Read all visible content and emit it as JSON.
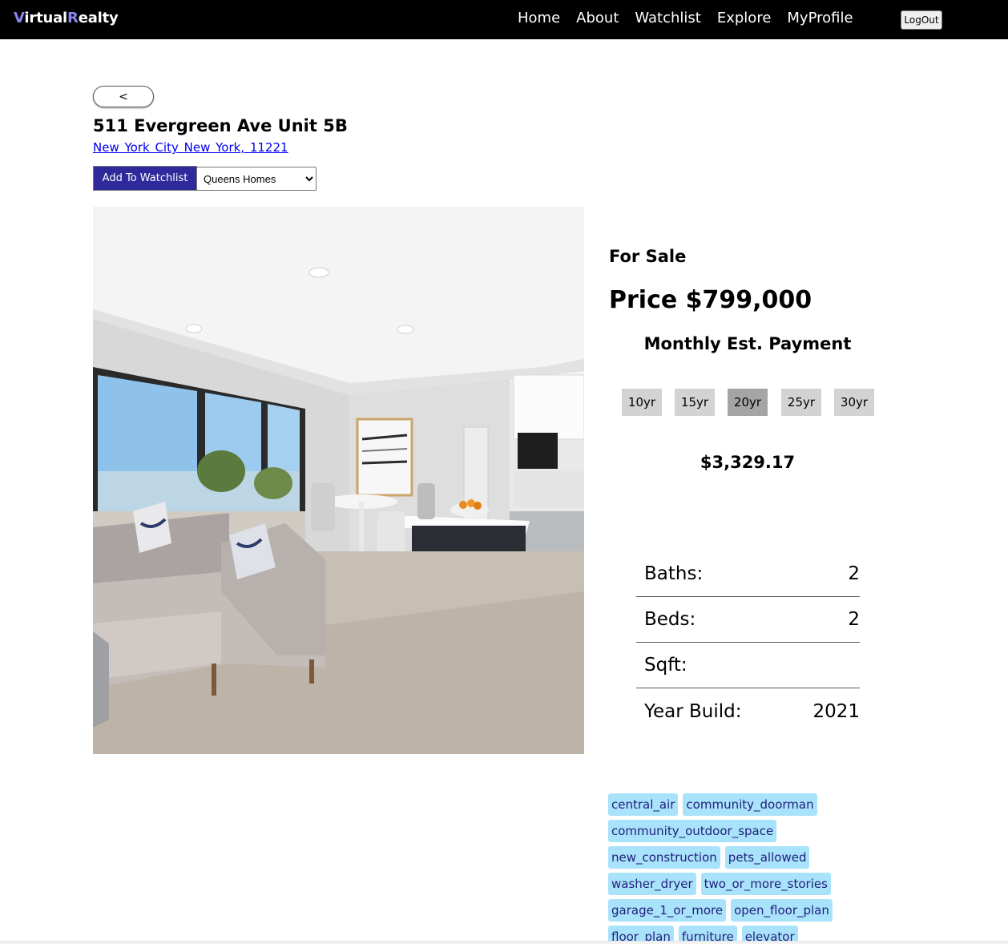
{
  "nav": {
    "brand_v": "V",
    "brand_irtual": "irtual",
    "brand_r": "R",
    "brand_ealty": "ealty",
    "links": [
      "Home",
      "About",
      "Watchlist",
      "Explore",
      "MyProfile"
    ],
    "logout": "LogOut"
  },
  "listing": {
    "back": "<",
    "address": "511 Evergreen Ave Unit 5B",
    "location": "New York City New York, 11221",
    "add_watchlist": "Add To Watchlist",
    "watchlist_selected": "Queens Homes",
    "status": "For Sale",
    "price": "Price $799,000",
    "monthly_heading": "Monthly Est. Payment",
    "terms": [
      "10yr",
      "15yr",
      "20yr",
      "25yr",
      "30yr"
    ],
    "active_term": "20yr",
    "monthly_amount": "$3,329.17",
    "stats": {
      "baths_label": "Baths:",
      "baths": "2",
      "beds_label": "Beds:",
      "beds": "2",
      "sqft_label": "Sqft:",
      "sqft": "",
      "year_label": "Year Build:",
      "year": "2021"
    },
    "tags": [
      [
        "central_air",
        "community_doorman"
      ],
      [
        "community_outdoor_space"
      ],
      [
        "new_construction",
        "pets_allowed"
      ],
      [
        "washer_dryer",
        "two_or_more_stories"
      ],
      [
        "garage_1_or_more",
        "open_floor_plan"
      ],
      [
        "floor_plan",
        "furniture",
        "elevator"
      ]
    ]
  },
  "colors": {
    "navbar": "#000000",
    "brand_accent": "#8a84f0",
    "watchlist_button": "#2f2a9c",
    "tag_bg": "#a9e2fb",
    "tag_text": "#1f1f7a",
    "term_active": "#a5a5a5",
    "term_default": "#d3d3d3"
  }
}
